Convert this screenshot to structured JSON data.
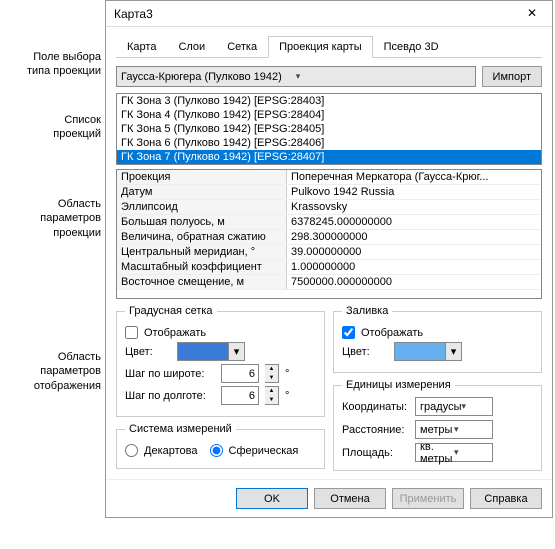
{
  "window": {
    "title": "Карта3"
  },
  "annotations": {
    "a1": "Поле выбора\nтипа проекции",
    "a2": "Список\nпроекций",
    "a3": "Область\nпараметров\nпроекции",
    "a4": "Область\nпараметров\nотображения"
  },
  "tabs": {
    "t1": "Карта",
    "t2": "Слои",
    "t3": "Сетка",
    "t4": "Проекция карты",
    "t5": "Псевдо 3D"
  },
  "top": {
    "combo": "Гаусса-Крюгера (Пулково 1942)",
    "import": "Импорт"
  },
  "list": {
    "i0": "ГК Зона 3 (Пулково 1942) [EPSG:28403]",
    "i1": "ГК Зона 4 (Пулково 1942) [EPSG:28404]",
    "i2": "ГК Зона 5 (Пулково 1942) [EPSG:28405]",
    "i3": "ГК Зона 6 (Пулково 1942) [EPSG:28406]",
    "i4": "ГК Зона 7 (Пулково 1942) [EPSG:28407]"
  },
  "details": {
    "k0": "Проекция",
    "v0": "Поперечная Меркатора (Гаусса-Крюг...",
    "k1": "Датум",
    "v1": "Pulkovo 1942 Russia",
    "k2": "Эллипсоид",
    "v2": "Krassovsky",
    "k3": "Большая полуось, м",
    "v3": "6378245.000000000",
    "k4": "Величина, обратная сжатию",
    "v4": "298.300000000",
    "k5": "Центральный меридиан, °",
    "v5": "39.000000000",
    "k6": "Масштабный коэффициент",
    "v6": "1.000000000",
    "k7": "Восточное смещение, м",
    "v7": "7500000.000000000"
  },
  "grid": {
    "legend": "Градусная сетка",
    "show": "Отображать",
    "color": "Цвет:",
    "lat": "Шаг по широте:",
    "lon": "Шаг по долготе:",
    "lat_val": "6",
    "lon_val": "6",
    "swatch": "#3a7bd5"
  },
  "fill": {
    "legend": "Заливка",
    "show": "Отображать",
    "color": "Цвет:",
    "swatch": "#66b0f0"
  },
  "sys": {
    "legend": "Система измерений",
    "cart": "Декартова",
    "sph": "Сферическая"
  },
  "units": {
    "legend": "Единицы измерения",
    "coord": "Координаты:",
    "coord_v": "градусы",
    "dist": "Расстояние:",
    "dist_v": "метры",
    "area": "Площадь:",
    "area_v": "кв. метры"
  },
  "footer": {
    "ok": "OK",
    "cancel": "Отмена",
    "apply": "Применить",
    "help": "Справка"
  }
}
